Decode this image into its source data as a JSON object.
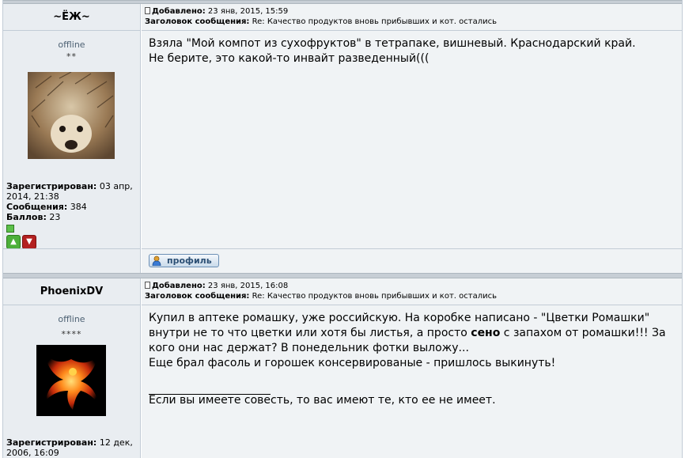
{
  "posts": [
    {
      "username": "~ЁЖ~",
      "added_label": "Добавлено:",
      "added_date": "23 янв, 2015, 15:59",
      "subject_label": "Заголовок сообщения:",
      "subject": "Re: Качество продуктов вновь прибывших и кот. остались",
      "status": "offline",
      "stars": "**",
      "avatar_icon": "hedgehog-avatar",
      "registered_label": "Зарегистрирован:",
      "registered_line1": "03 апр,",
      "registered_line2": "2014, 21:38",
      "messages_label": "Сообщения:",
      "messages": "384",
      "points_label": "Баллов:",
      "points": "23",
      "body_lines": [
        "Взяла \"Мой компот из сухофруктов\" в тетрапаке, вишневый. Краснодарский край.",
        "Не берите, это какой-то инвайт разведенный((("
      ],
      "profile_label": "профиль"
    },
    {
      "username": "PhoenixDV",
      "added_label": "Добавлено:",
      "added_date": "23 янв, 2015, 16:08",
      "subject_label": "Заголовок сообщения:",
      "subject": "Re: Качество продуктов вновь прибывших и кот. остались",
      "status": "offline",
      "stars": "****",
      "avatar_icon": "phoenix-avatar",
      "registered_label": "Зарегистрирован:",
      "registered_line1": "12 дек,",
      "registered_line2": "2006, 16:09",
      "body_line1": "Купил в аптеке ромашку, уже российскую. На коробке написано - \"Цветки Ромашки\"",
      "body_line2_pre": "внутри не то что цветки или хотя бы листья, а просто ",
      "body_line2_bold": "сено",
      "body_line2_post": " с запахом от ромашки!!! За",
      "body_line3": "кого они нас держат? В понедельник фотки выложу...",
      "body_line4": "Еще брал фасоль и горошек консервированые - пришлось выкинуть!",
      "signature": "Если вы имеете совесть, то вас имеют те, кто ее не имеет."
    }
  ],
  "colors": {
    "accent": "#4d6173",
    "thumb_up": "#4caf3a",
    "thumb_down": "#b32020"
  }
}
